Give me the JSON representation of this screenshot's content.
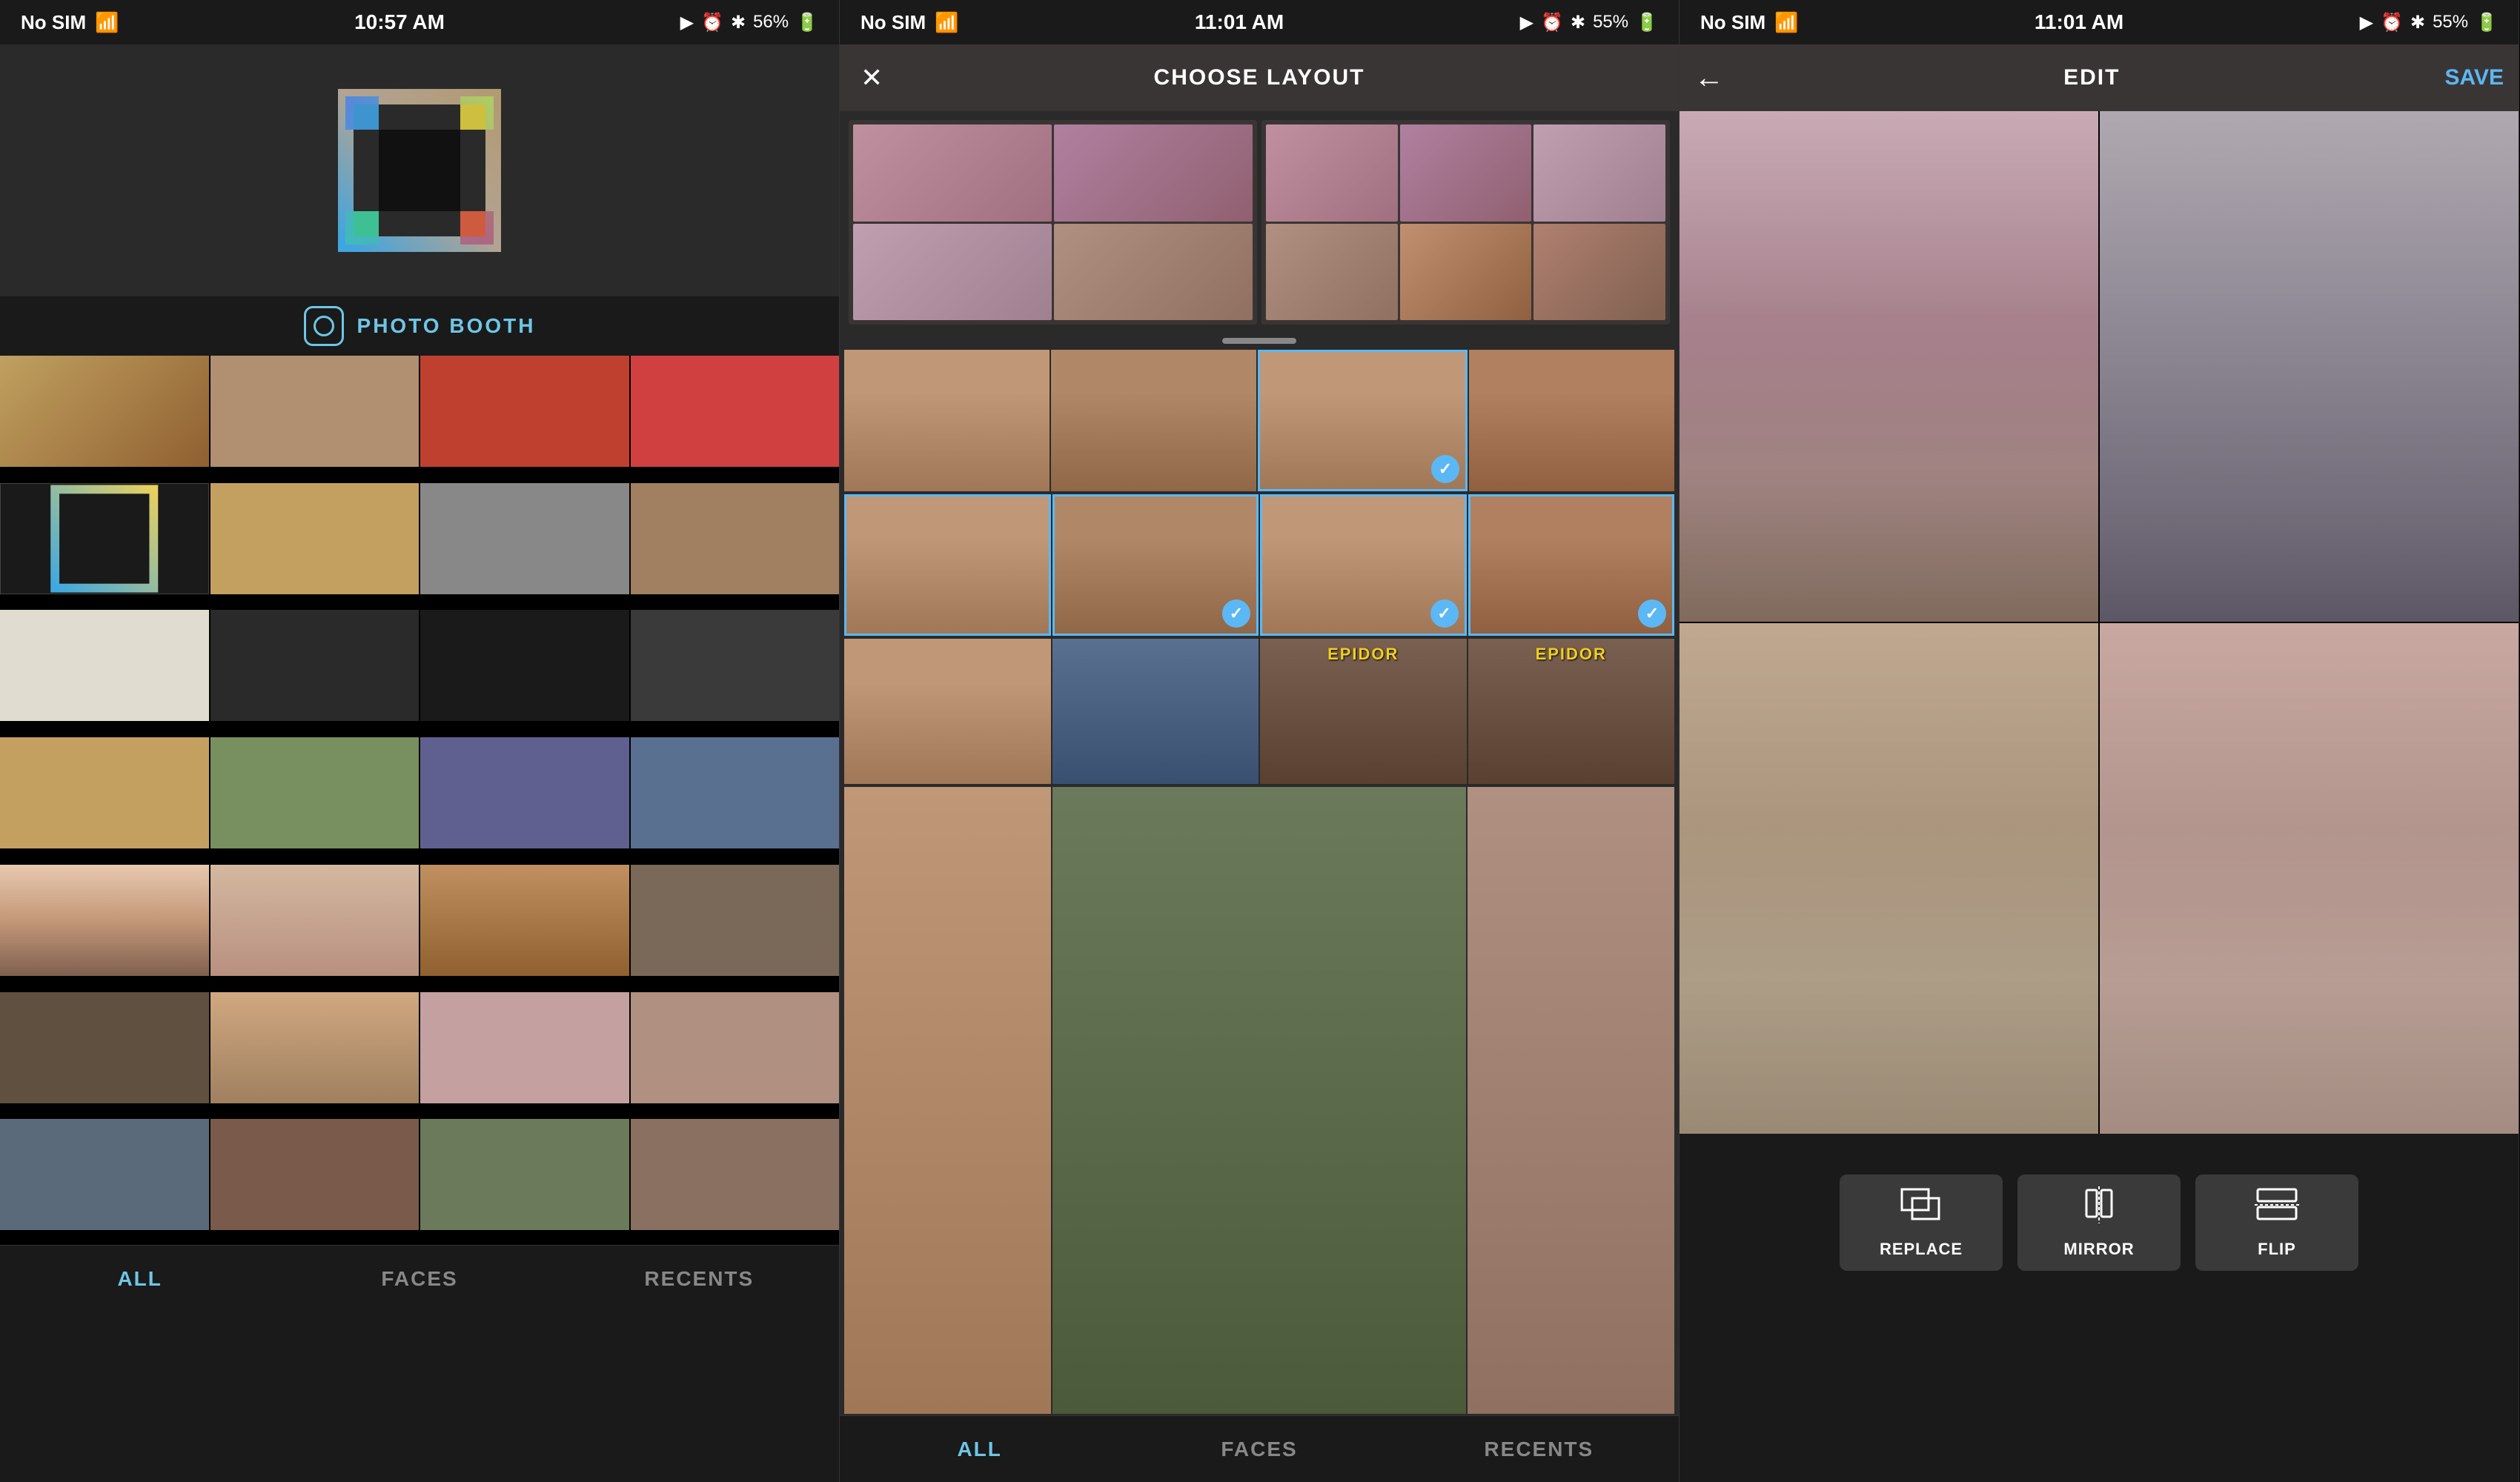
{
  "screens": [
    {
      "id": "screen1",
      "statusBar": {
        "left": "No SIM",
        "center": "10:57 AM",
        "right": "56%"
      },
      "photoBooth": {
        "label": "PHOTO BOOTH"
      },
      "tabs": [
        "ALL",
        "FACES",
        "RECENTS"
      ],
      "activeTab": "ALL"
    },
    {
      "id": "screen2",
      "statusBar": {
        "left": "No SIM",
        "center": "11:01 AM",
        "right": "55%"
      },
      "navBar": {
        "title": "CHOOSE LAYOUT",
        "closeBtn": "✕"
      },
      "tabs": [
        "ALL",
        "FACES",
        "RECENTS"
      ],
      "activeTab": "ALL"
    },
    {
      "id": "screen3",
      "statusBar": {
        "left": "No SIM",
        "center": "11:01 AM",
        "right": "55%"
      },
      "navBar": {
        "title": "EDIT",
        "backBtn": "←",
        "saveBtn": "SAVE"
      },
      "tools": [
        {
          "id": "replace",
          "label": "REPLACE",
          "icon": "⧉"
        },
        {
          "id": "mirror",
          "label": "MIRROR",
          "icon": "⊟"
        },
        {
          "id": "flip",
          "label": "FLIP",
          "icon": "⊠"
        }
      ]
    }
  ],
  "icons": {
    "wifiIcon": "wifi",
    "locationIcon": "▶",
    "clockIcon": "⏰",
    "bluetoothIcon": "✱",
    "batteryIcon": "▮",
    "checkmark": "✓",
    "close": "✕",
    "back": "←",
    "replace": "⧉",
    "mirror": "⊞",
    "flip": "⊟"
  },
  "epidor": "EPIDOR"
}
